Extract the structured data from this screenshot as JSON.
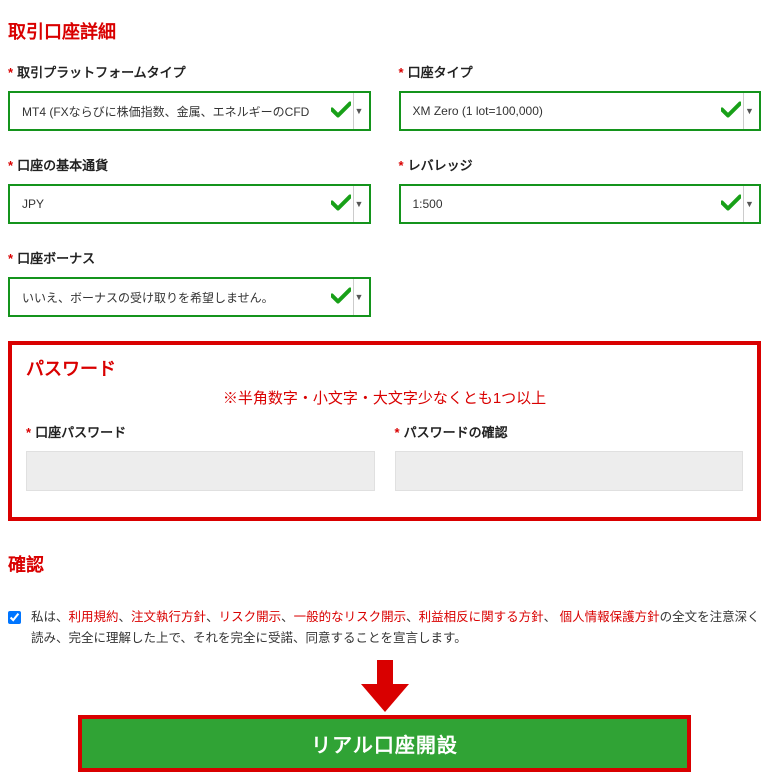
{
  "acctDetail": {
    "title": "取引口座詳細",
    "platform": {
      "label": "取引プラットフォームタイプ",
      "value": "MT4 (FXならびに株価指数、金属、エネルギーのCFD"
    },
    "accountType": {
      "label": "口座タイプ",
      "value": "XM Zero (1 lot=100,000)"
    },
    "currency": {
      "label": "口座の基本通貨",
      "value": "JPY"
    },
    "leverage": {
      "label": "レバレッジ",
      "value": "1:500"
    },
    "bonus": {
      "label": "口座ボーナス",
      "value": "いいえ、ボーナスの受け取りを希望しません。"
    }
  },
  "password": {
    "title": "パスワード",
    "hint": "※半角数字・小文字・大文字少なくとも1つ以上",
    "pw1Label": "口座パスワード",
    "pw2Label": "パスワードの確認"
  },
  "confirm": {
    "title": "確認",
    "prefix": "私は、",
    "links": {
      "l1": "利用規約",
      "l2": "注文執行方針",
      "l3": "リスク開示",
      "l4": "一般的なリスク開示",
      "l5": "利益相反に関する方針",
      "l6": "個人情報保護方針"
    },
    "sep": "、",
    "sepSpace": "、 ",
    "suffix": "の全文を注意深く読み、完全に理解した上で、それを完全に受諾、同意することを宣言します。"
  },
  "submit": {
    "label": "リアル口座開設"
  }
}
